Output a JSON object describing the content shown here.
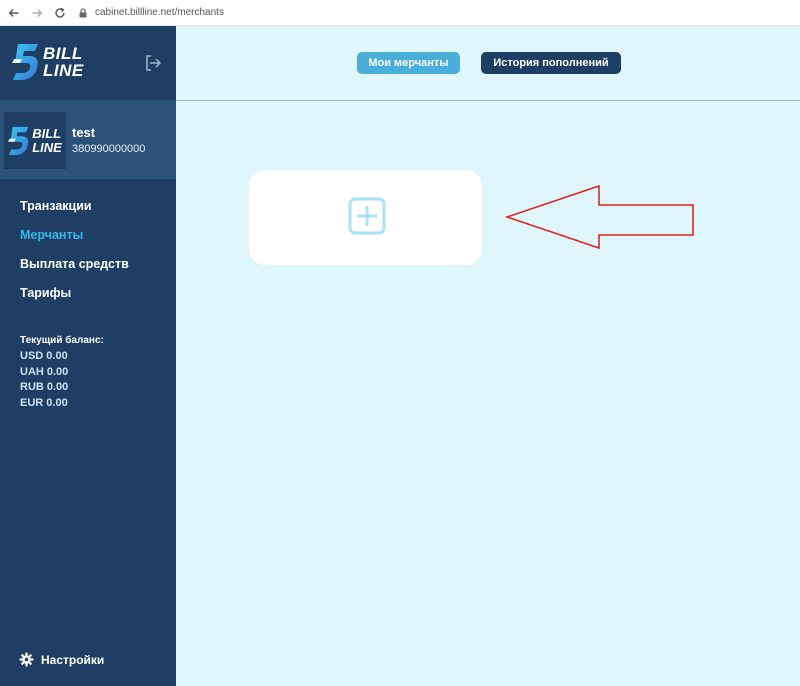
{
  "browser": {
    "url": "cabinet.billline.net/merchants"
  },
  "brand": {
    "logo_line1": "BILL",
    "logo_line2": "LINE",
    "colors": {
      "sidebar": "#1e3f63",
      "profile_bg": "#2c5279",
      "accent": "#35b6ec",
      "main_bg": "#dff6fd",
      "tab_active": "#4aaedb",
      "annotation": "#e0241b"
    }
  },
  "profile": {
    "name": "test",
    "phone": "380990000000"
  },
  "sidebar": {
    "items": [
      {
        "label": "Транзакции",
        "active": false
      },
      {
        "label": "Мерчанты",
        "active": true
      },
      {
        "label": "Выплата средств",
        "active": false
      },
      {
        "label": "Тарифы",
        "active": false
      }
    ],
    "balance_title": "Текущий баланс:",
    "balances": [
      {
        "text": "USD 0.00"
      },
      {
        "text": "UAH 0.00"
      },
      {
        "text": "RUB 0.00"
      },
      {
        "text": "EUR 0.00"
      }
    ],
    "settings_label": "Настройки"
  },
  "topnav": {
    "tabs": [
      {
        "label": "Мои мерчанты",
        "active": true
      },
      {
        "label": "История пополнений",
        "active": false
      }
    ]
  },
  "icons": {
    "back": "arrow-left-icon",
    "forward": "arrow-right-icon",
    "reload": "reload-icon",
    "lock": "lock-icon",
    "logout": "logout-icon",
    "add": "plus-square-icon",
    "settings": "gear-icon"
  }
}
